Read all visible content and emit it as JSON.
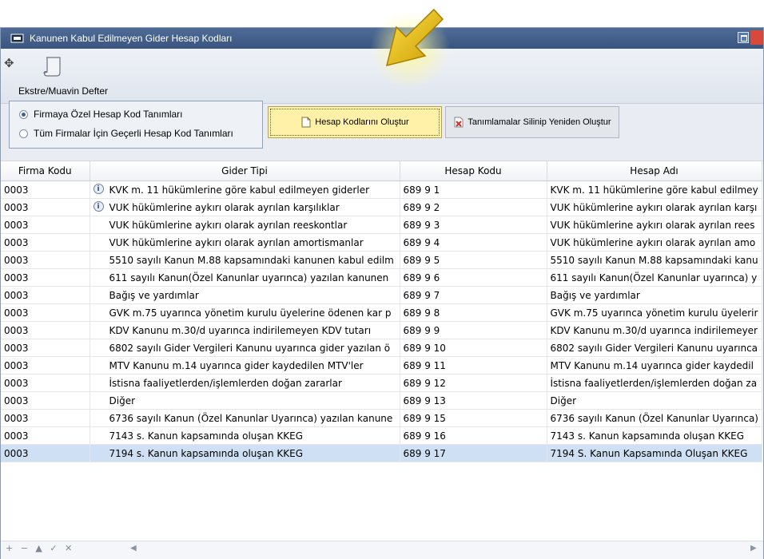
{
  "window": {
    "title": "Kanunen Kabul Edilmeyen Gider Hesap Kodları"
  },
  "toolbar": {
    "ekstre_label": "Ekstre/Muavin Defter"
  },
  "radio_options": [
    {
      "label": "Firmaya Özel Hesap Kod Tanımları",
      "selected": true
    },
    {
      "label": "Tüm Firmalar İçin Geçerli Hesap Kod Tanımları",
      "selected": false
    }
  ],
  "buttons": {
    "create_label": "Hesap Kodlarını Oluştur",
    "reset_label": "Tanımlamalar Silinip Yeniden Oluştur"
  },
  "grid": {
    "headers": [
      "Firma Kodu",
      "Gider Tipi",
      "Hesap Kodu",
      "Hesap Adı"
    ],
    "rows": [
      {
        "firma": "0003",
        "gider": "KVK m. 11 hükümlerine göre kabul edilmeyen giderler",
        "kod": "689 9 1",
        "ad": "KVK m. 11 hükümlerine göre kabul edilmey",
        "info": true
      },
      {
        "firma": "0003",
        "gider": "VUK hükümlerine aykırı olarak ayrılan karşılıklar",
        "kod": "689 9 2",
        "ad": "VUK hükümlerine aykırı olarak ayrılan karşı",
        "info": true
      },
      {
        "firma": "0003",
        "gider": "VUK hükümlerine aykırı olarak ayrılan reeskontlar",
        "kod": "689 9 3",
        "ad": "VUK hükümlerine aykırı olarak ayrılan rees",
        "info": false
      },
      {
        "firma": "0003",
        "gider": "VUK hükümlerine aykırı olarak ayrılan amortismanlar",
        "kod": "689 9 4",
        "ad": "VUK hükümlerine aykırı olarak ayrılan amo",
        "info": false
      },
      {
        "firma": "0003",
        "gider": "5510 sayılı Kanun M.88 kapsamındaki kanunen kabul edilm",
        "kod": "689 9 5",
        "ad": "5510 sayılı Kanun M.88 kapsamındaki kanu",
        "info": false
      },
      {
        "firma": "0003",
        "gider": "611 sayılı Kanun(Özel Kanunlar uyarınca) yazılan kanunen",
        "kod": "689 9 6",
        "ad": "611 sayılı Kanun(Özel Kanunlar uyarınca) y",
        "info": false
      },
      {
        "firma": "0003",
        "gider": "Bağış ve yardımlar",
        "kod": "689 9 7",
        "ad": "Bağış ve yardımlar",
        "info": false
      },
      {
        "firma": "0003",
        "gider": "GVK m.75 uyarınca yönetim kurulu üyelerine ödenen kar p",
        "kod": "689 9 8",
        "ad": "GVK m.75 uyarınca yönetim kurulu üyelerir",
        "info": false
      },
      {
        "firma": "0003",
        "gider": "KDV Kanunu m.30/d uyarınca indirilemeyen KDV tutarı",
        "kod": "689 9 9",
        "ad": "KDV Kanunu m.30/d uyarınca indirilemeyer",
        "info": false
      },
      {
        "firma": "0003",
        "gider": "6802 sayılı Gider Vergileri Kanunu uyarınca gider yazılan ö",
        "kod": "689 9 10",
        "ad": "6802 sayılı Gider Vergileri Kanunu uyarınca",
        "info": false
      },
      {
        "firma": "0003",
        "gider": "MTV Kanunu m.14 uyarınca gider kaydedilen MTV'ler",
        "kod": "689 9 11",
        "ad": "MTV Kanunu m.14 uyarınca gider kaydedil",
        "info": false
      },
      {
        "firma": "0003",
        "gider": "İstisna faaliyetlerden/işlemlerden doğan zararlar",
        "kod": "689 9 12",
        "ad": "İstisna faaliyetlerden/işlemlerden doğan za",
        "info": false
      },
      {
        "firma": "0003",
        "gider": "Diğer",
        "kod": "689 9 13",
        "ad": "Diğer",
        "info": false
      },
      {
        "firma": "0003",
        "gider": "6736 sayılı Kanun (Özel Kanunlar Uyarınca) yazılan kanune",
        "kod": "689 9 15",
        "ad": "6736 sayılı Kanun (Özel Kanunlar Uyarınca)",
        "info": false
      },
      {
        "firma": "0003",
        "gider": "7143 s. Kanun kapsamında oluşan KKEG",
        "kod": "689 9 16",
        "ad": "7143 s. Kanun kapsamında oluşan KKEG",
        "info": false
      },
      {
        "firma": "0003",
        "gider": "7194 s. Kanun kapsamında oluşan KKEG",
        "kod": "689 9 17",
        "ad": "7194 S. Kanun Kapsamında Oluşan KKEG",
        "info": false
      }
    ],
    "selected_row": 15
  },
  "footer": {
    "nav_symbols": "+ − ▲ ✓ ✕"
  },
  "colors": {
    "highlight_button": "#fff2a8",
    "selected_row": "#cfe0f5",
    "titlebar": "#3f5b86"
  }
}
